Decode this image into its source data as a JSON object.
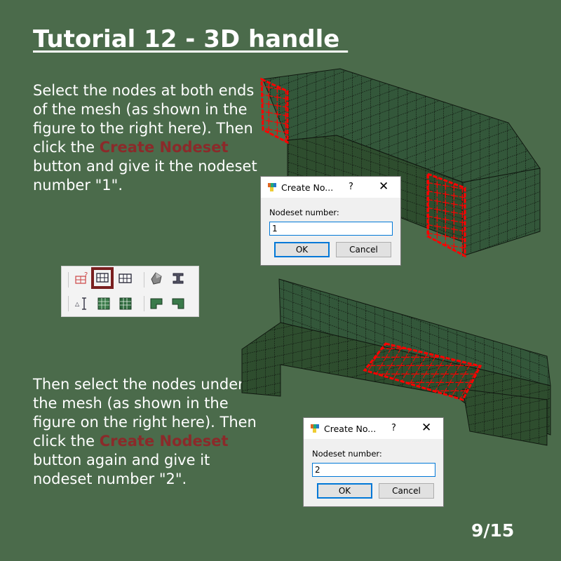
{
  "slide": {
    "title": "Tutorial 12 - 3D handle ",
    "step1": {
      "before": "Select the nodes at both ends of the mesh (as shown in the figure to the right here). Then click the ",
      "highlight": "Create Nodeset",
      "after": " button and give it the nodeset number \"1\"."
    },
    "step2": {
      "before": "Then select the nodes under the mesh (as shown in the figure on the right here). Then click the ",
      "highlight": "Create Nodeset",
      "after": " button again and give it nodeset number \"2\"."
    },
    "page": "9/15"
  },
  "dialogs": [
    {
      "title": "Create No...",
      "help": "?",
      "close": "✕",
      "label": "Nodeset number:",
      "value": "1",
      "ok": "OK",
      "cancel": "Cancel"
    },
    {
      "title": "Create No...",
      "help": "?",
      "close": "✕",
      "label": "Nodeset number:",
      "value": "2",
      "ok": "OK",
      "cancel": "Cancel"
    }
  ],
  "toolbar": {
    "row1": [
      "delete-nodeset-icon",
      "create-nodeset-icon",
      "create-sideset-icon",
      "solid-icon",
      "beam-icon"
    ],
    "row2": [
      "measure-icon",
      "green-grid-icon",
      "green-mesh-icon",
      "l-block-icon",
      "l-block-alt-icon"
    ],
    "selected": "create-nodeset-icon"
  },
  "colors": {
    "background": "#4b6b4b",
    "mesh_fill": "#2e4d2e",
    "mesh_line": "#101810",
    "selection": "#ff0000",
    "highlight_text": "#8b2a2a",
    "toolbar_selected_border": "#7a2020"
  }
}
